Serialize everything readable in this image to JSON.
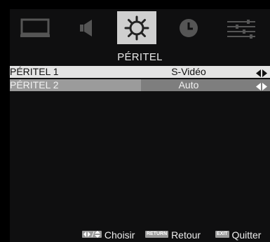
{
  "menu": {
    "title": "PÉRITEL",
    "tabs": [
      {
        "name": "display-icon",
        "active": false
      },
      {
        "name": "speaker-icon",
        "active": false
      },
      {
        "name": "gear-icon",
        "active": true
      },
      {
        "name": "clock-icon",
        "active": false
      },
      {
        "name": "sliders-icon",
        "active": false
      }
    ]
  },
  "rows": [
    {
      "label": "PÉRITEL 1",
      "value": "S-Vidéo",
      "selected": false
    },
    {
      "label": "PÉRITEL 2",
      "value": "Auto",
      "selected": true
    }
  ],
  "footer": {
    "choose_label": "Choisir",
    "return_key": "RETURN",
    "return_label": "Retour",
    "exit_key": "EXIT",
    "exit_label": "Quitter"
  },
  "colors": {
    "background": "#000000",
    "panel": "#0f0f10",
    "active_tab": "#cfcfcf",
    "row_normal": "#e4e4e4",
    "row_selected": "#7e7e7e"
  }
}
